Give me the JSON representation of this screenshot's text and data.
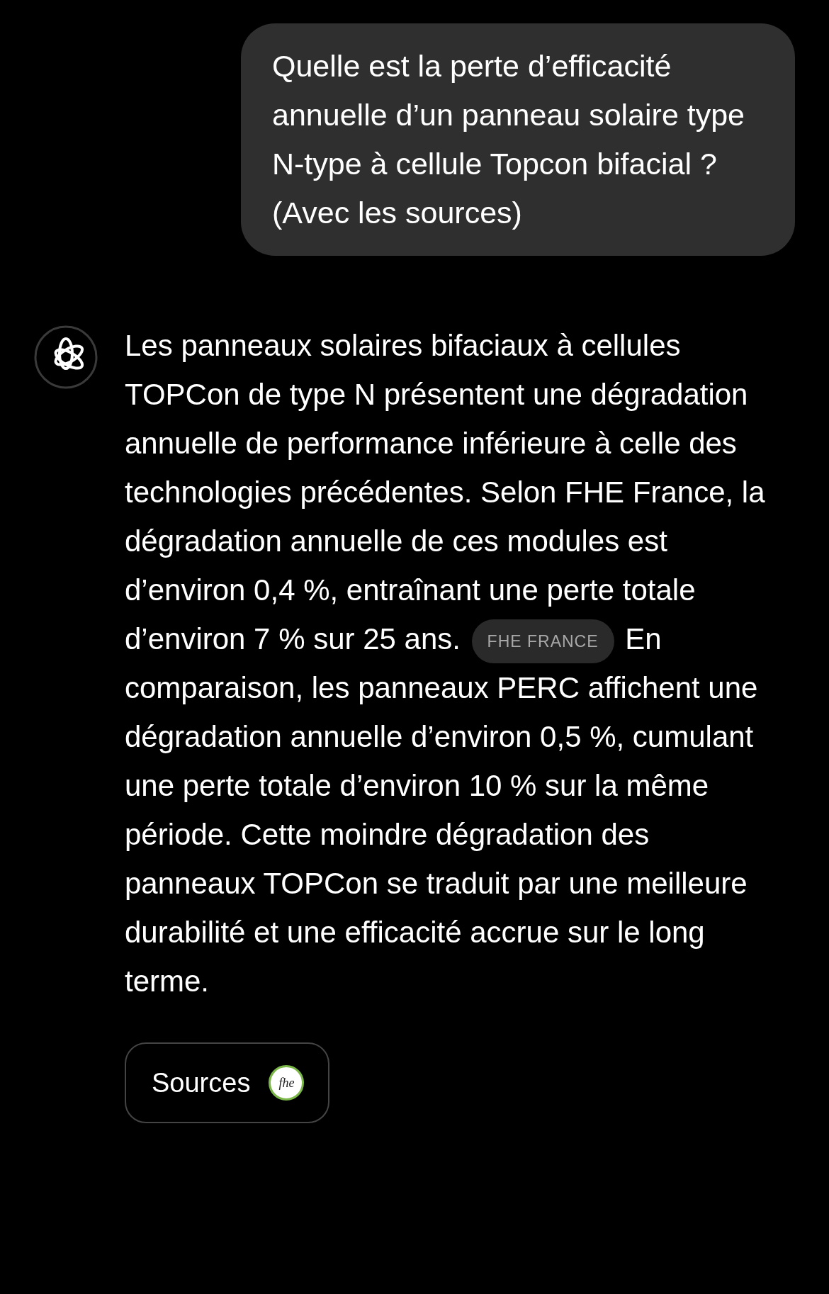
{
  "user_message": {
    "text": "Quelle est la perte d’efficacité annuelle d’un panneau solaire type N-type à cellule Topcon bifacial ? (Avec les sources)"
  },
  "assistant_message": {
    "text_before": "Les panneaux solaires bifaciaux à cellules TOPCon de type N présentent une dégradation annuelle de performance inférieure à celle des technologies précédentes. Selon FHE France, la dégradation annuelle de ces modules est d’environ 0,4 %, entraînant une perte totale d’environ 7 % sur 25 ans.",
    "citation": "FHE FRANCE",
    "text_after": "En comparaison, les panneaux PERC affichent une dégradation annuelle d’environ 0,5 %, cumulant une perte totale d’environ 10 % sur la même période. Cette moindre dégradation des panneaux TOPCon se traduit par une meilleure durabilité et une efficacité accrue sur le long terme."
  },
  "sources_button": {
    "label": "Sources",
    "logo_text": "fhe"
  }
}
